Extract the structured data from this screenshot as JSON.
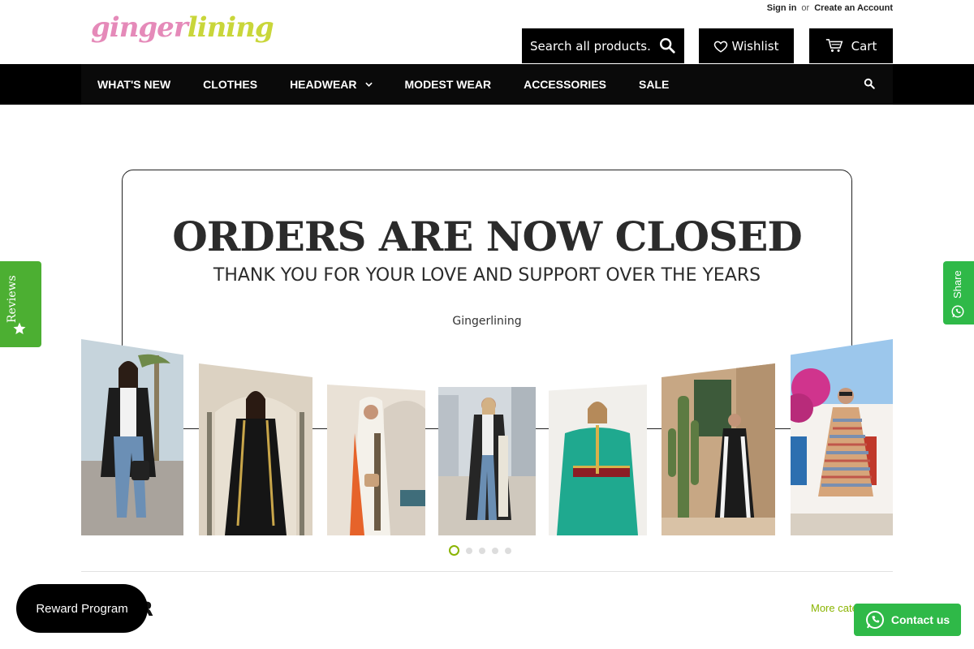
{
  "header": {
    "sign_in": "Sign in",
    "or": "or",
    "create_account": "Create an Account",
    "logo_part1": "ginger",
    "logo_part2": "lining",
    "search_placeholder": "Search all products...",
    "wishlist": "Wishlist",
    "cart": "Cart"
  },
  "nav": {
    "items": [
      "WHAT'S NEW",
      "CLOTHES",
      "HEADWEAR",
      "MODEST WEAR",
      "ACCESSORIES",
      "SALE"
    ]
  },
  "hero": {
    "title": "ORDERS ARE NOW CLOSED",
    "subtitle": "THANK YOU FOR YOUR LOVE AND SUPPORT OVER THE YEARS",
    "brand": "Gingerlining"
  },
  "carousel": {
    "slides": 5,
    "active_index": 0
  },
  "section": {
    "title": "OR",
    "more_link": "More cate"
  },
  "widgets": {
    "reviews": "Reviews",
    "share": "Share",
    "reward": "Reward Program",
    "contact": "Contact us"
  },
  "colors": {
    "accent_green": "#8ab400",
    "widget_green": "#2fb948",
    "logo_pink": "#e58ab9",
    "logo_green": "#c9d63a"
  }
}
